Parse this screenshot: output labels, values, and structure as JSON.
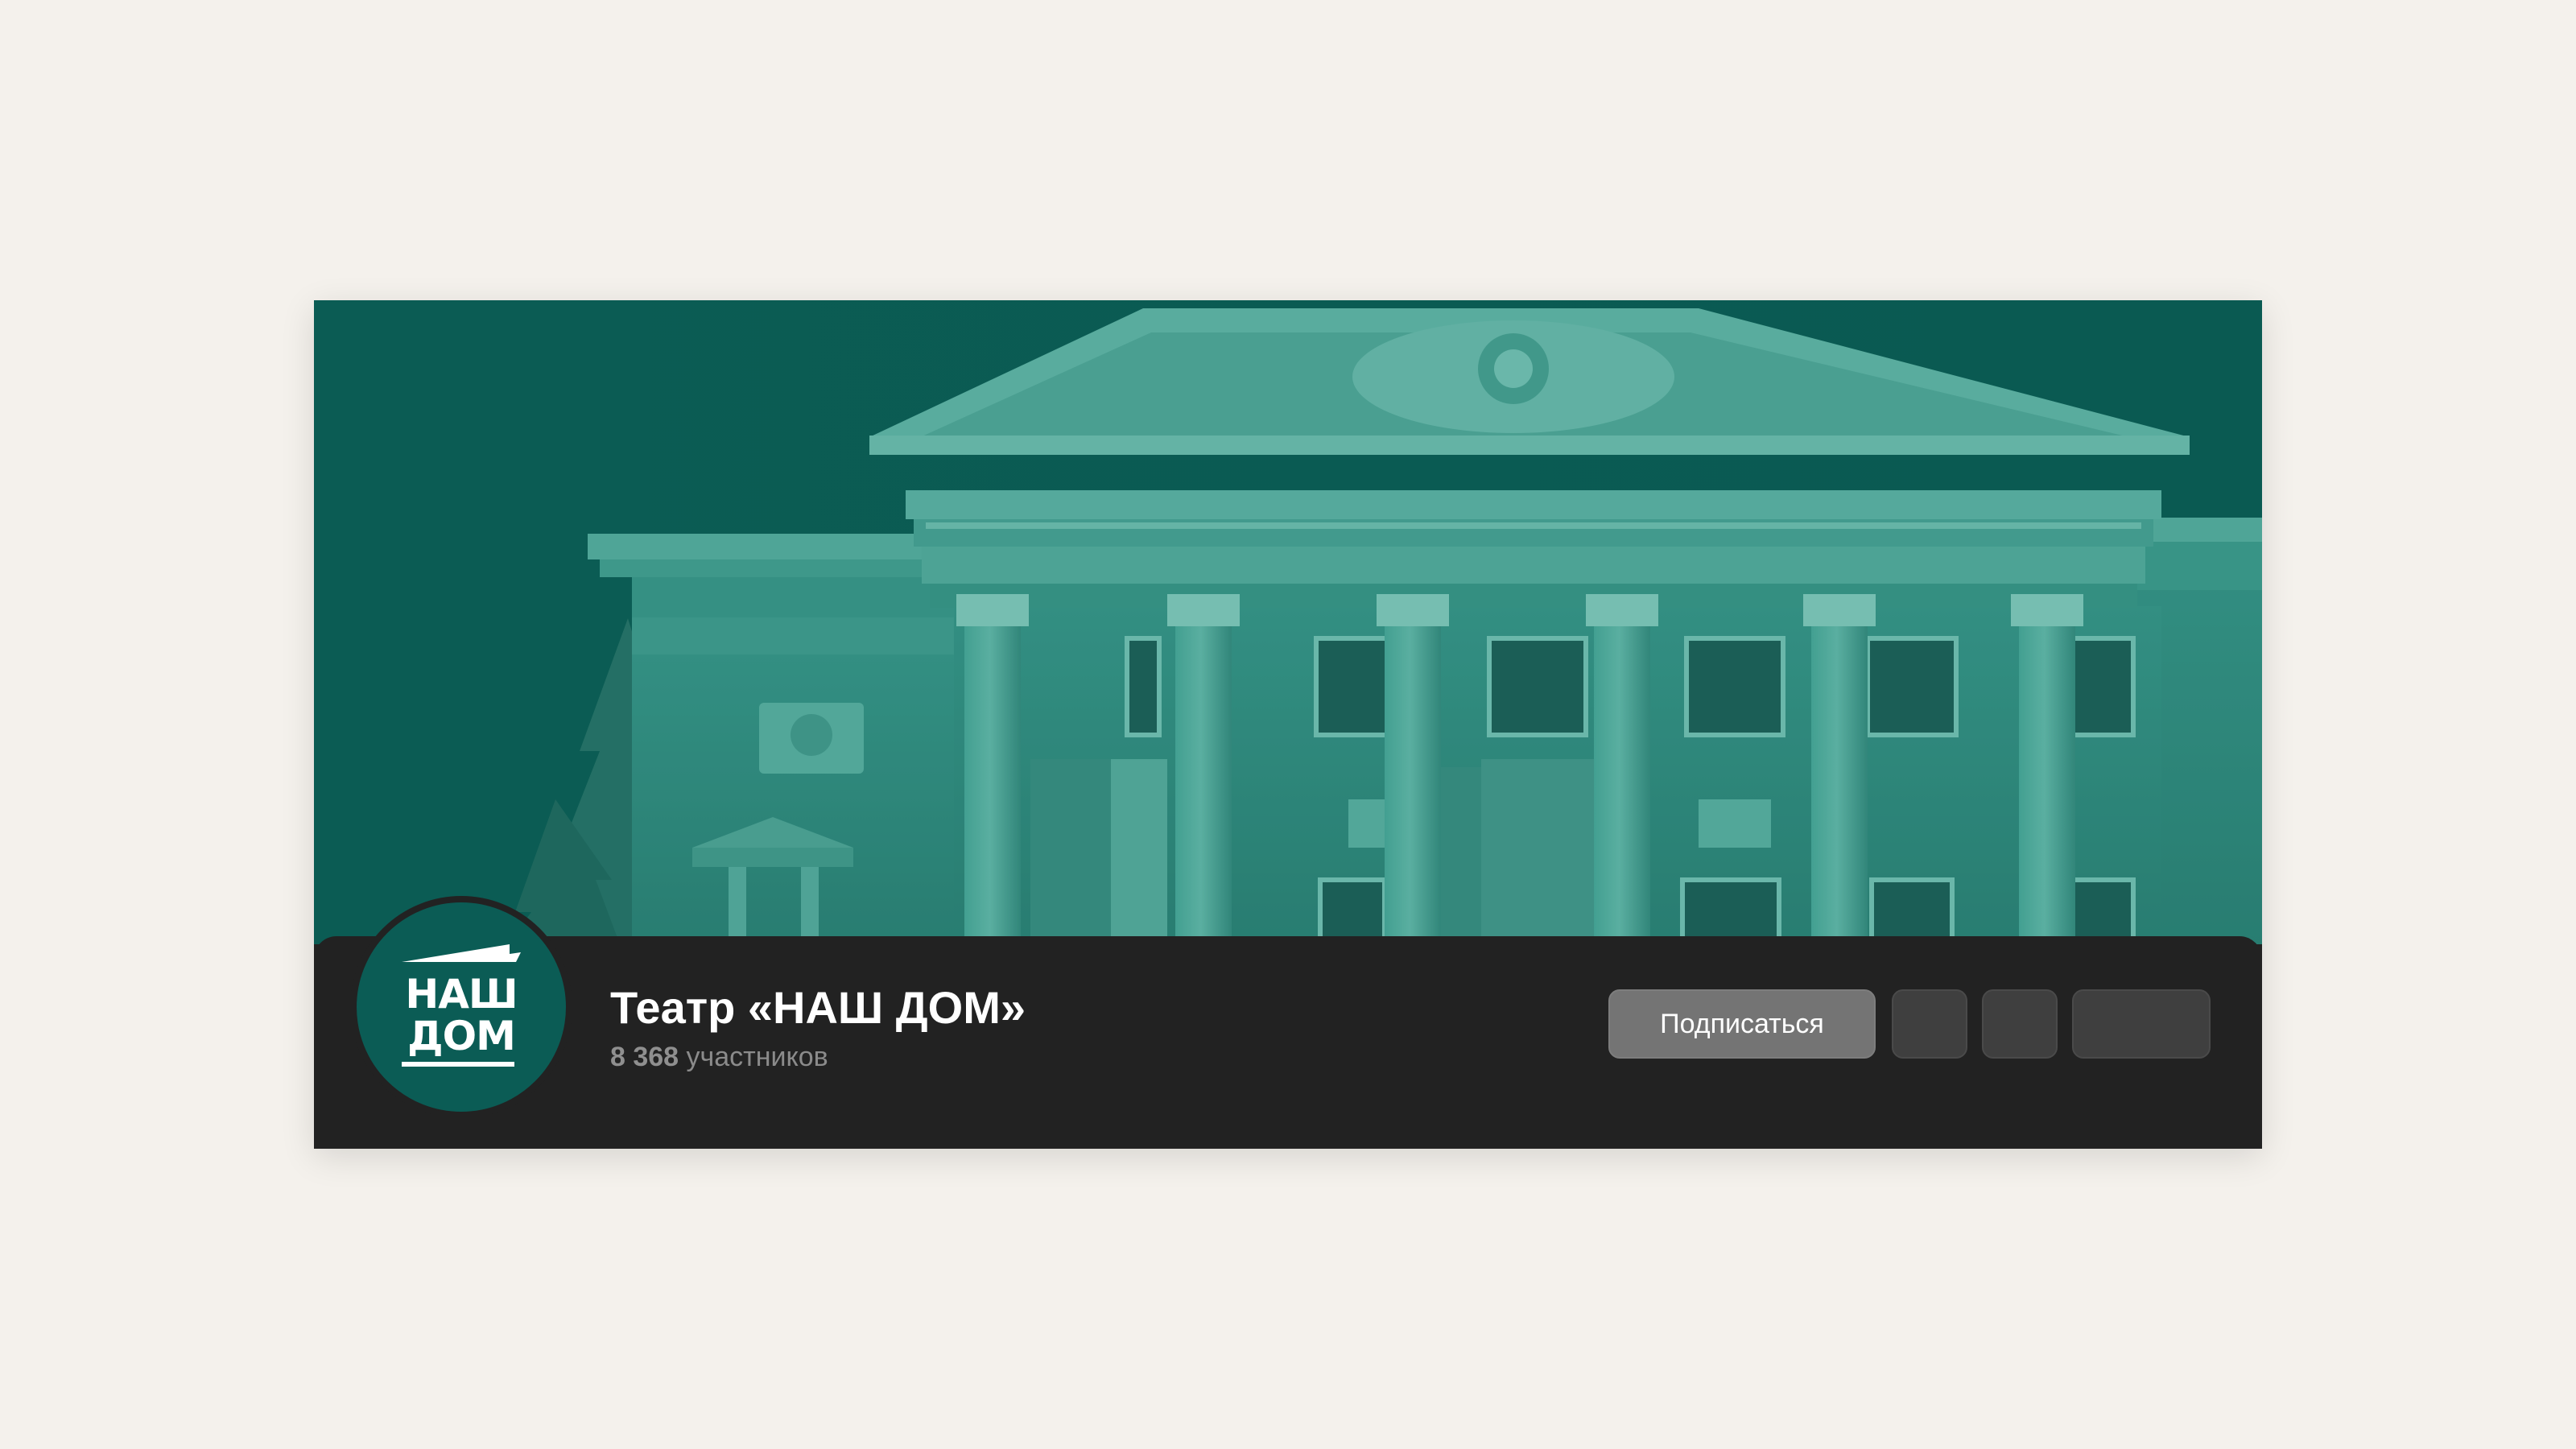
{
  "colors": {
    "page_background": "#f4f1ec",
    "brand_teal": "#0b5c55",
    "info_bar": "#222222",
    "subscribe_button": "#747474",
    "secondary_button": "#3f3f3f"
  },
  "cover": {
    "icon": "theatre-building-image"
  },
  "avatar": {
    "line1": "НАШ",
    "line2": "ДОМ"
  },
  "community": {
    "title": "Театр «НАШ ДОМ»",
    "members_count": "8 368",
    "members_label": "участников"
  },
  "actions": {
    "subscribe_label": "Подписаться"
  }
}
